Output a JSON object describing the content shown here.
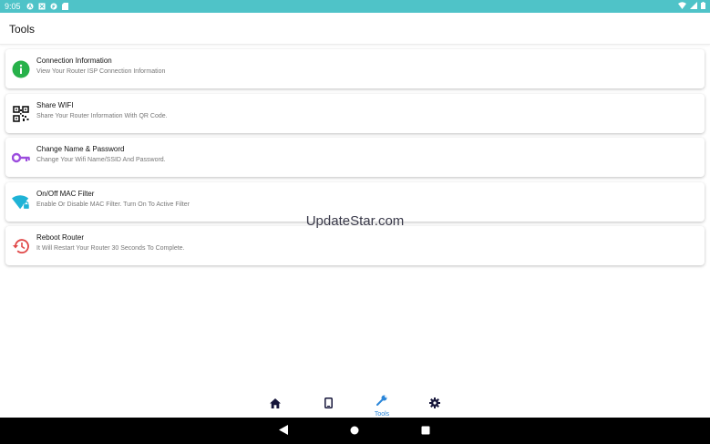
{
  "status_bar": {
    "time": "9:05"
  },
  "app_bar": {
    "title": "Tools"
  },
  "items": [
    {
      "title": "Connection Information",
      "subtitle": "View Your Router ISP Connection Information",
      "icon": "info-icon",
      "color": "#27b14a"
    },
    {
      "title": "Share WIFI",
      "subtitle": "Share Your Router Information With QR Code.",
      "icon": "qr-code-icon",
      "color": "#111111"
    },
    {
      "title": "Change Name & Password",
      "subtitle": "Change Your Wifi Name/SSID And Password.",
      "icon": "key-icon",
      "color": "#9c4dde"
    },
    {
      "title": "On/Off MAC Filter",
      "subtitle": "Enable Or Disable MAC Filter. Turn On To Active Filter",
      "icon": "wifi-lock-icon",
      "color": "#1fb3d6"
    },
    {
      "title": "Reboot Router",
      "subtitle": "It Will Restart Your Router 30 Seconds To Complete.",
      "icon": "history-icon",
      "color": "#e04848"
    }
  ],
  "watermark": "UpdateStar.com",
  "bottom_nav": {
    "items": [
      {
        "icon": "home-icon"
      },
      {
        "icon": "tablet-icon"
      },
      {
        "icon": "wrench-icon",
        "label": "Tools",
        "active": true
      },
      {
        "icon": "gear-icon"
      }
    ],
    "accent": "#2b86d9",
    "inactive": "#15153a"
  }
}
